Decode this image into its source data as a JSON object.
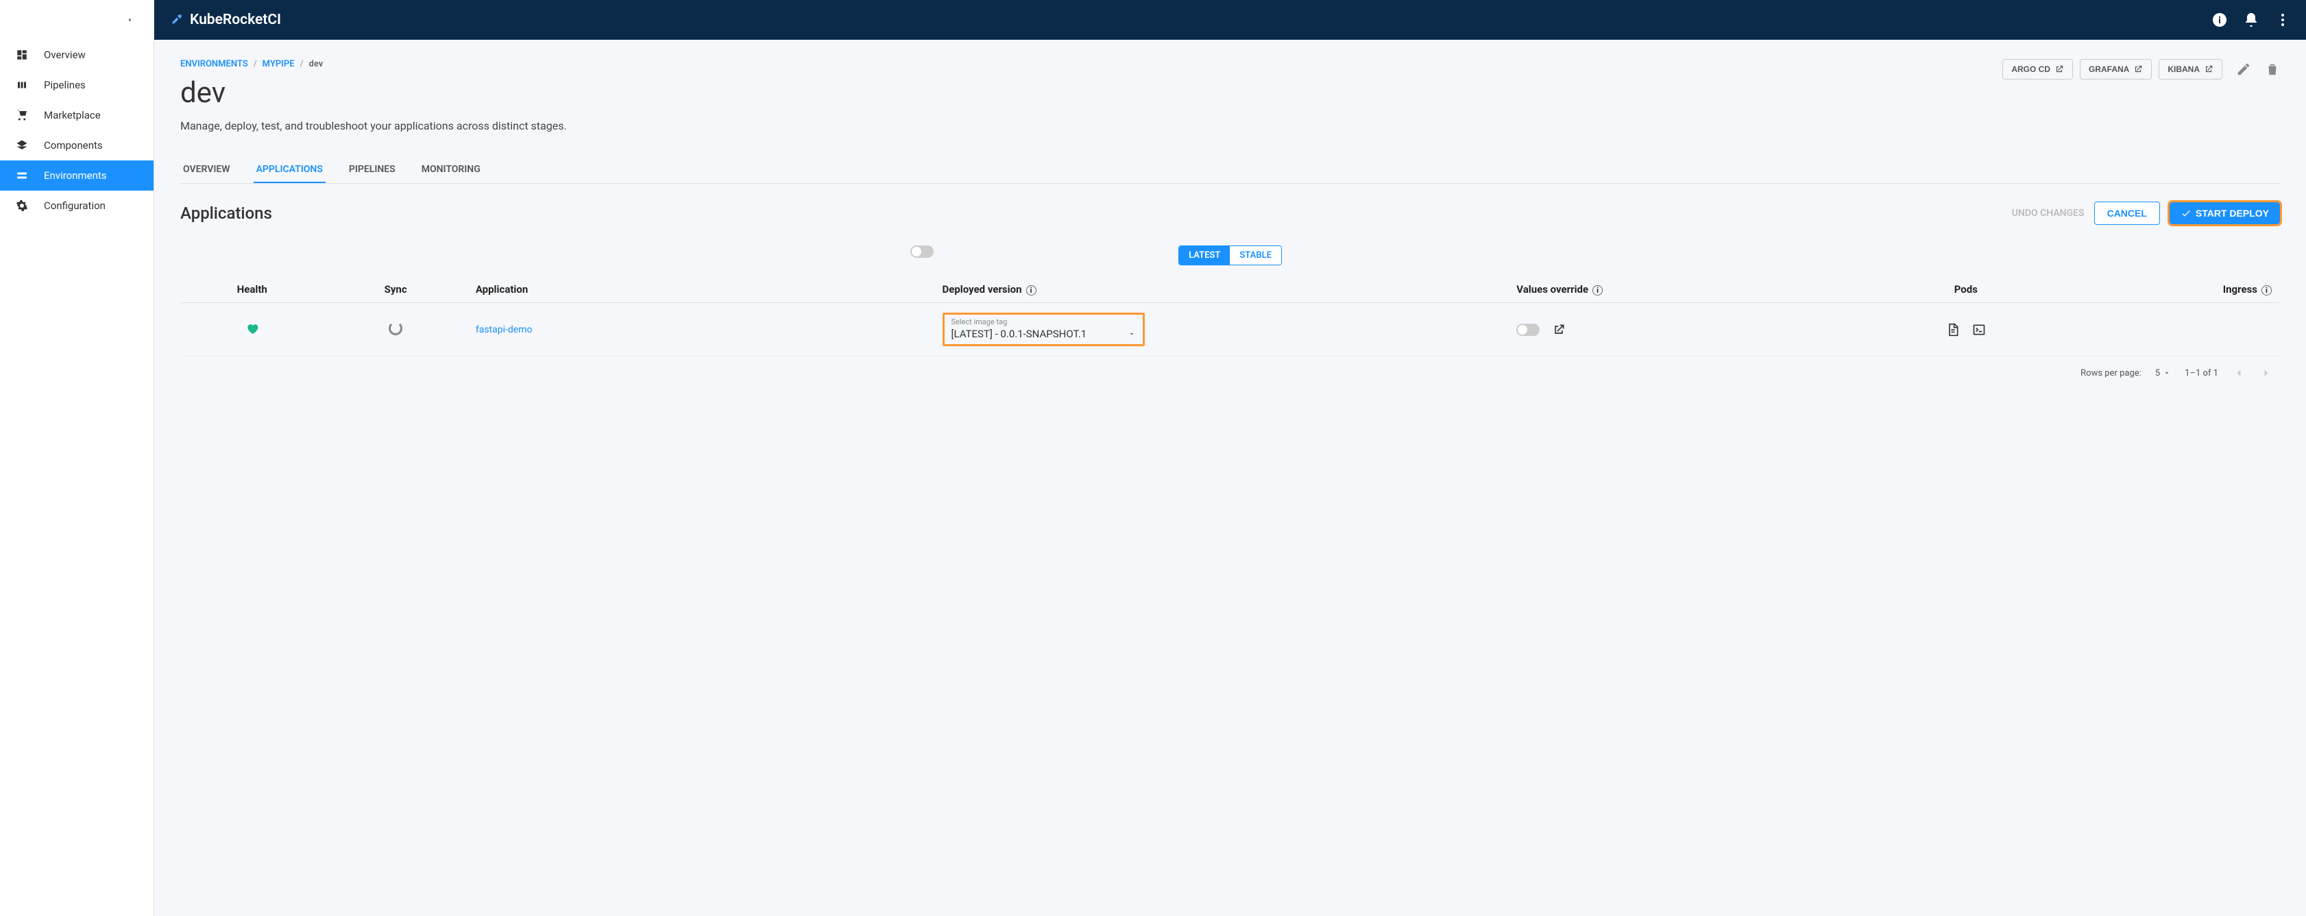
{
  "brand": "KubeRocketCI",
  "sidebar": {
    "items": [
      {
        "label": "Overview"
      },
      {
        "label": "Pipelines"
      },
      {
        "label": "Marketplace"
      },
      {
        "label": "Components"
      },
      {
        "label": "Environments"
      },
      {
        "label": "Configuration"
      }
    ]
  },
  "breadcrumb": {
    "env": "ENVIRONMENTS",
    "pipe": "MYPIPE",
    "stage": "dev"
  },
  "page": {
    "title": "dev",
    "subtitle": "Manage, deploy, test, and troubleshoot your applications across distinct stages."
  },
  "links": {
    "argo": "ARGO CD",
    "grafana": "GRAFANA",
    "kibana": "KIBANA"
  },
  "tabs": {
    "overview": "OVERVIEW",
    "applications": "APPLICATIONS",
    "pipelines": "PIPELINES",
    "monitoring": "MONITORING"
  },
  "section": {
    "title": "Applications",
    "undo": "UNDO CHANGES",
    "cancel": "CANCEL",
    "deploy": "START DEPLOY"
  },
  "pills": {
    "latest": "LATEST",
    "stable": "STABLE"
  },
  "table": {
    "headers": {
      "health": "Health",
      "sync": "Sync",
      "application": "Application",
      "deployed": "Deployed version",
      "values": "Values override",
      "pods": "Pods",
      "ingress": "Ingress"
    },
    "row": {
      "app_name": "fastapi-demo",
      "select_label": "Select image tag",
      "select_value": "[LATEST] - 0.0.1-SNAPSHOT.1"
    }
  },
  "pagination": {
    "rows_label": "Rows per page:",
    "rows_value": "5",
    "range": "1–1 of 1"
  }
}
